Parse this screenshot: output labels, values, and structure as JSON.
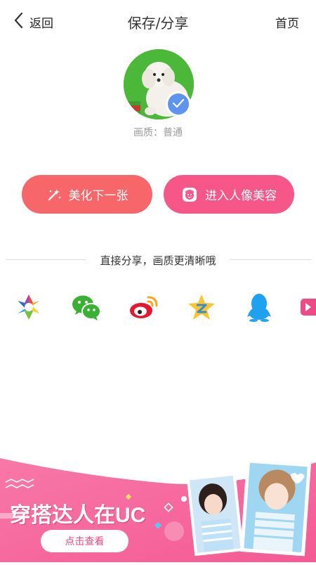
{
  "header": {
    "back_label": "返回",
    "title": "保存/分享",
    "home_label": "首页"
  },
  "preview": {
    "quality_text": "画质：普通"
  },
  "actions": {
    "beautify_next_label": "美化下一张",
    "portrait_beauty_label": "进入人像美容"
  },
  "share": {
    "divider_text": "直接分享，画质更清晰哦",
    "targets": [
      "camera-aperture-icon",
      "wechat-icon",
      "weibo-icon",
      "qzone-icon",
      "qq-icon",
      "more-share-icon"
    ]
  },
  "banner": {
    "title": "穿搭达人在UC",
    "button_label": "点击查看"
  },
  "colors": {
    "accent_coral": "#f76668",
    "accent_pink": "#f65788",
    "badge_blue": "#5f93f0",
    "banner_pink": "#f56aa0"
  }
}
